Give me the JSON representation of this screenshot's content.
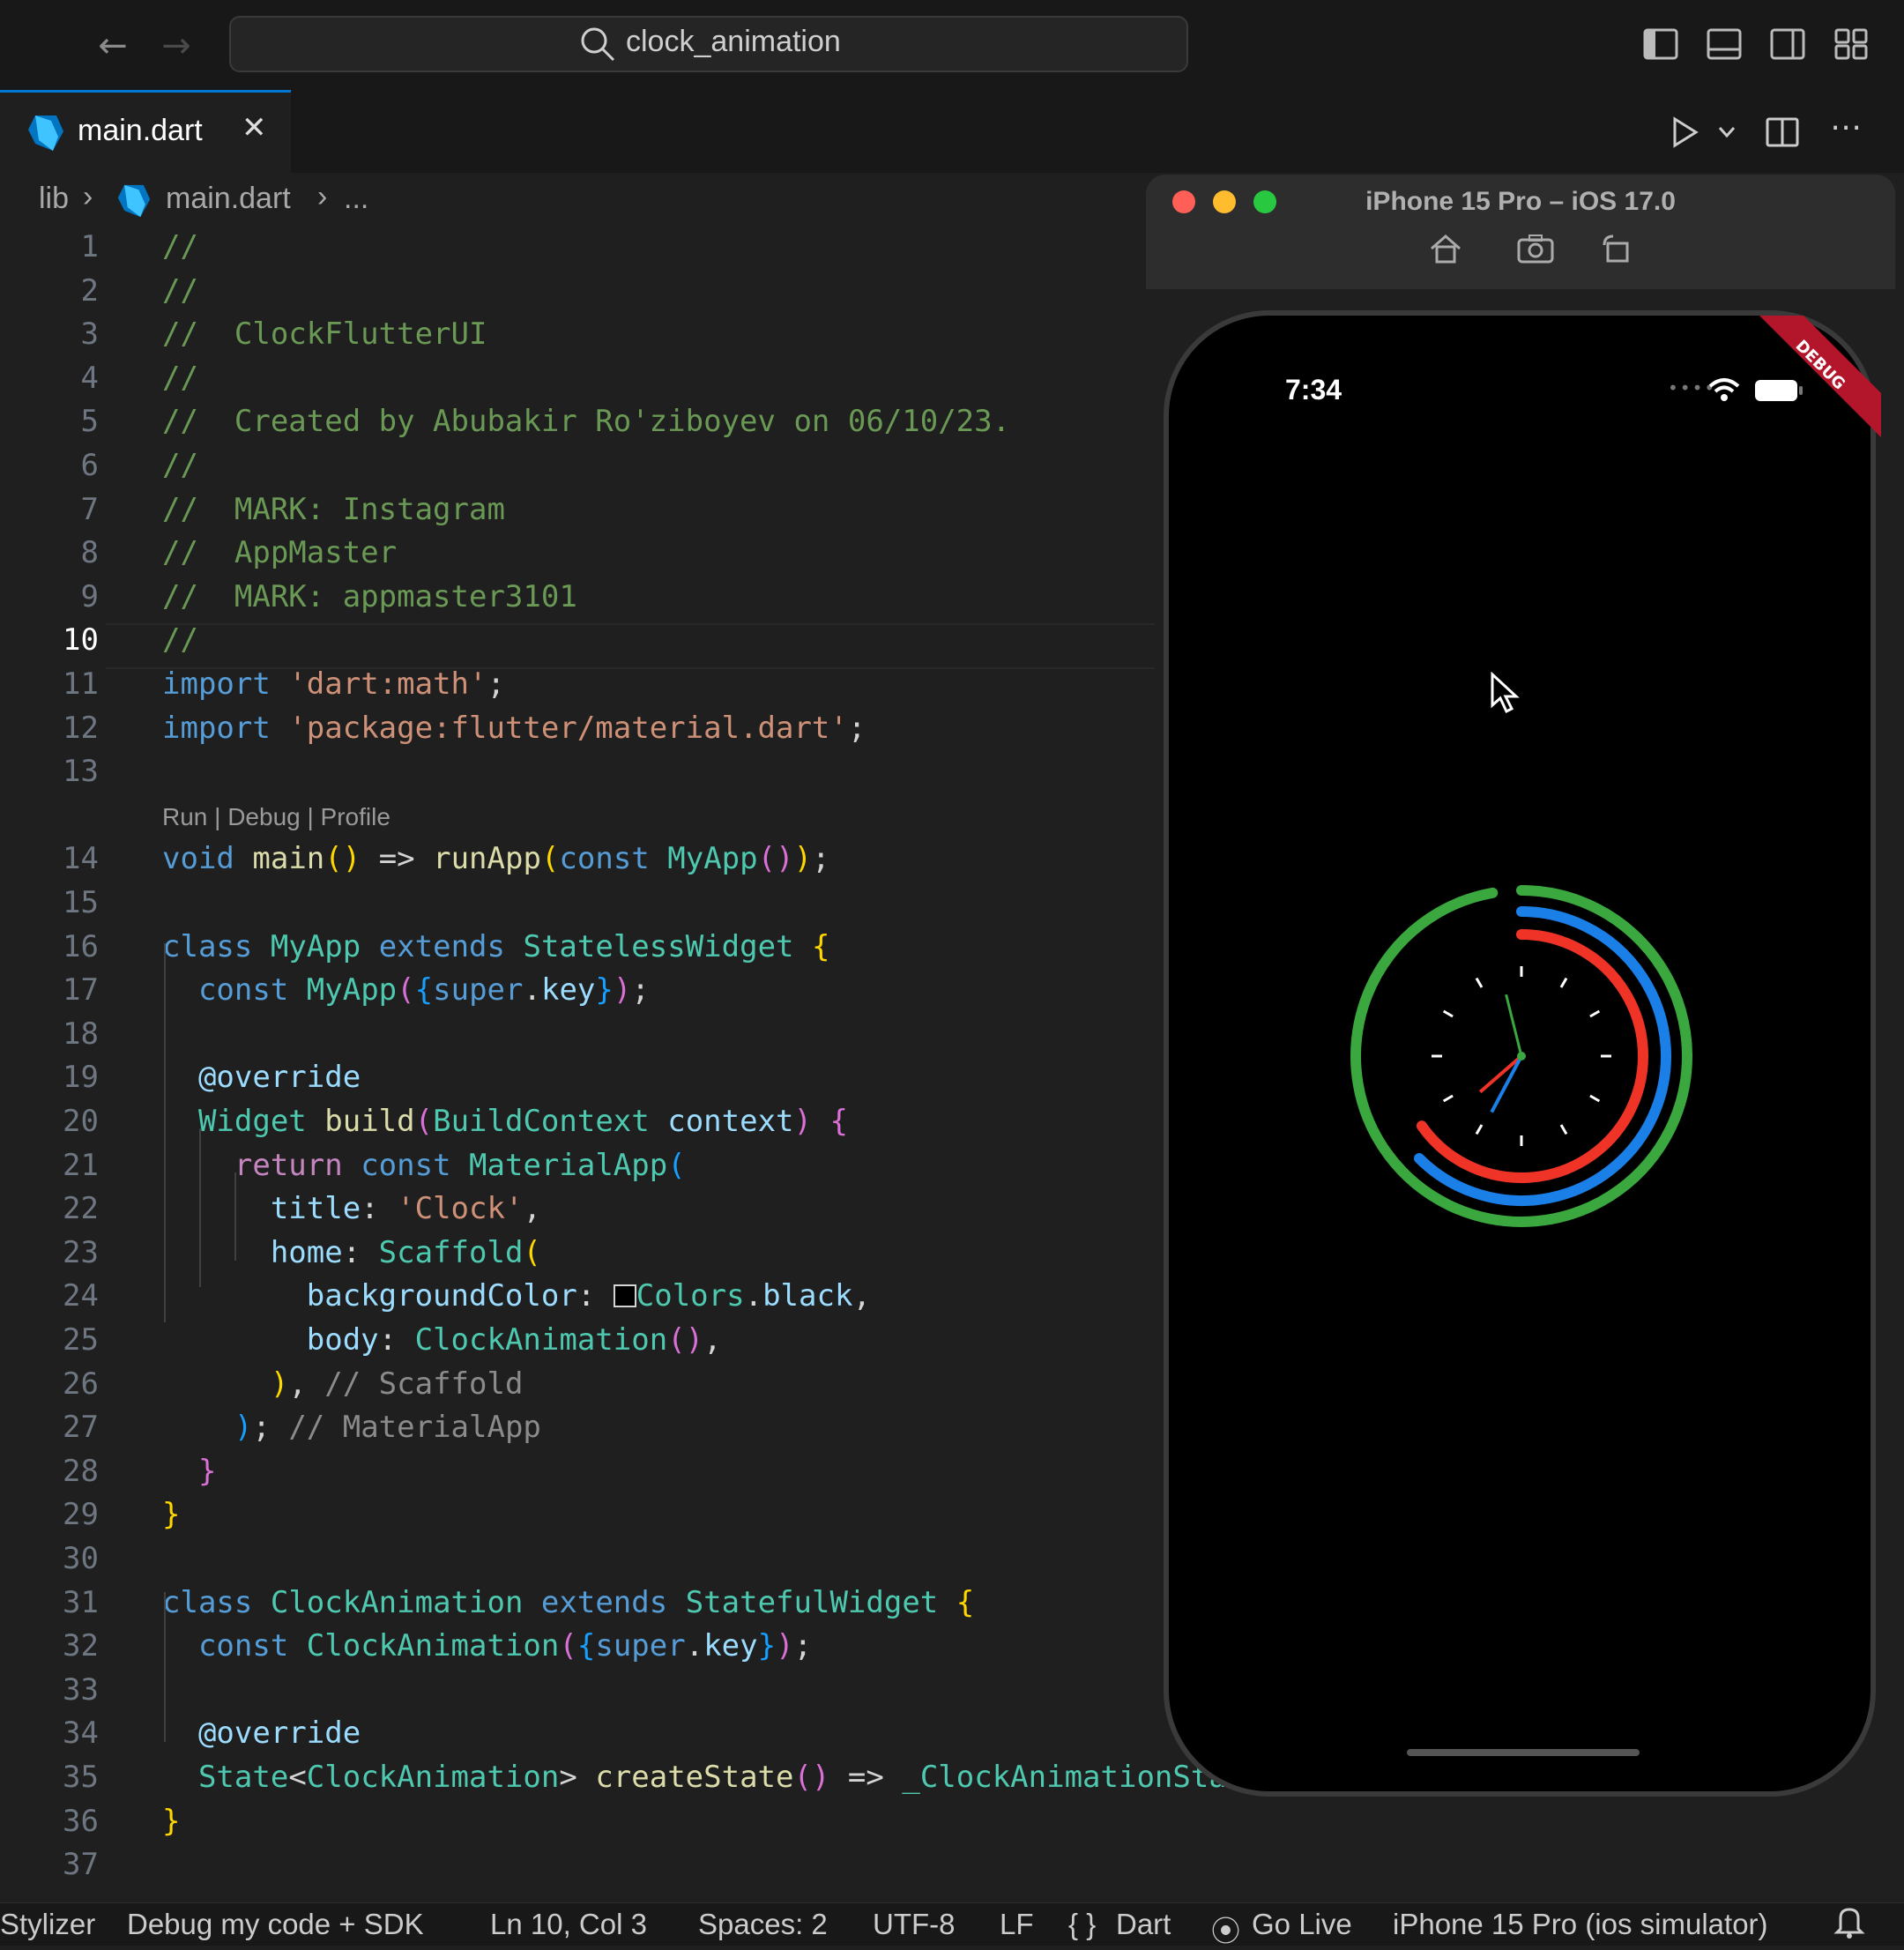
{
  "search": {
    "text": "clock_animation"
  },
  "tab": {
    "label": "main.dart",
    "close": "✕"
  },
  "breadcrumb": {
    "root": "lib",
    "file": "main.dart",
    "more": "..."
  },
  "code_lens": "Run | Debug | Profile",
  "code": [
    {
      "n": "1",
      "html": "<span class='c'>//</span>"
    },
    {
      "n": "2",
      "html": "<span class='c'>//</span>"
    },
    {
      "n": "3",
      "html": "<span class='c'>//  ClockFlutterUI</span>"
    },
    {
      "n": "4",
      "html": "<span class='c'>//</span>"
    },
    {
      "n": "5",
      "html": "<span class='c'>//  Created by Abubakir Ro'ziboyev on 06/10/23.</span>"
    },
    {
      "n": "6",
      "html": "<span class='c'>//</span>"
    },
    {
      "n": "7",
      "html": "<span class='c'>//  MARK: Instagram</span>"
    },
    {
      "n": "8",
      "html": "<span class='c'>//  AppMaster</span>"
    },
    {
      "n": "9",
      "html": "<span class='c'>//  MARK: appmaster3101</span>"
    },
    {
      "n": "10",
      "html": "<span class='c'>//</span>"
    },
    {
      "n": "11",
      "html": "<span class='k'>import</span> <span class='s'>'dart:math'</span>;"
    },
    {
      "n": "12",
      "html": "<span class='k'>import</span> <span class='s'>'package:flutter/material.dart'</span>;"
    },
    {
      "n": "13",
      "html": ""
    },
    {
      "n": "14",
      "html": "<span class='k'>void</span> <span class='f'>main</span><span class='y'>()</span> =&gt; <span class='f'>runApp</span><span class='y'>(</span><span class='k'>const</span> <span class='t'>MyApp</span><span class='p'>()</span><span class='y'>)</span>;"
    },
    {
      "n": "15",
      "html": ""
    },
    {
      "n": "16",
      "html": "<span class='k'>class</span> <span class='t'>MyApp</span> <span class='k'>extends</span> <span class='t'>StatelessWidget</span> <span class='y'>{</span>"
    },
    {
      "n": "17",
      "html": "  <span class='k'>const</span> <span class='t'>MyApp</span><span class='p'>(</span><span class='b'>{</span><span class='k'>super</span>.<span class='v'>key</span><span class='b'>}</span><span class='p'>)</span>;"
    },
    {
      "n": "18",
      "html": ""
    },
    {
      "n": "19",
      "html": "  <span class='v'>@override</span>"
    },
    {
      "n": "20",
      "html": "  <span class='t'>Widget</span> <span class='f'>build</span><span class='p'>(</span><span class='t'>BuildContext</span> <span class='v'>context</span><span class='p'>)</span> <span class='p'>{</span>"
    },
    {
      "n": "21",
      "html": "    <span class='kw'>return</span> <span class='k'>const</span> <span class='t'>MaterialApp</span><span class='b'>(</span>"
    },
    {
      "n": "22",
      "html": "      <span class='v'>title</span>: <span class='s'>'Clock'</span>,"
    },
    {
      "n": "23",
      "html": "      <span class='v'>home</span>: <span class='t'>Scaffold</span><span class='y'>(</span>"
    },
    {
      "n": "24",
      "html": "        <span class='v'>backgroundColor</span>: <span style='display:inline-block;width:22px;height:22px;border:2px solid #d4d4d4;background:#000;vertical-align:-2px;'></span><span class='t'>Colors</span>.<span class='v'>black</span>,"
    },
    {
      "n": "25",
      "html": "        <span class='v'>body</span>: <span class='t'>ClockAnimation</span><span class='p'>()</span>,"
    },
    {
      "n": "26",
      "html": "      <span class='y'>)</span>, <span class='c' style='color:#8b8b8b'>// Scaffold</span>"
    },
    {
      "n": "27",
      "html": "    <span class='b'>)</span>; <span class='c' style='color:#8b8b8b'>// MaterialApp</span>"
    },
    {
      "n": "28",
      "html": "  <span class='p'>}</span>"
    },
    {
      "n": "29",
      "html": "<span class='y'>}</span>"
    },
    {
      "n": "30",
      "html": ""
    },
    {
      "n": "31",
      "html": "<span class='k'>class</span> <span class='t'>ClockAnimation</span> <span class='k'>extends</span> <span class='t'>StatefulWidget</span> <span class='y'>{</span>"
    },
    {
      "n": "32",
      "html": "  <span class='k'>const</span> <span class='t'>ClockAnimation</span><span class='p'>(</span><span class='b'>{</span><span class='k'>super</span>.<span class='v'>key</span><span class='b'>}</span><span class='p'>)</span>;"
    },
    {
      "n": "33",
      "html": ""
    },
    {
      "n": "34",
      "html": "  <span class='v'>@override</span>"
    },
    {
      "n": "35",
      "html": "  <span class='t'>State</span>&lt;<span class='t'>ClockAnimation</span>&gt; <span class='f'>createState</span><span class='p'>()</span> =&gt; <span class='t'>_ClockAnimationStat</span>"
    },
    {
      "n": "36",
      "html": "<span class='y'>}</span>"
    },
    {
      "n": "37",
      "html": ""
    }
  ],
  "simulator": {
    "title": "iPhone 15 Pro – iOS 17.0",
    "time": "7:34",
    "debug_banner": "DEBUG"
  },
  "clock": {
    "ring_colors": {
      "outer": "#3aa83e",
      "middle": "#1a7fe6",
      "inner": "#ef3327"
    },
    "hand_colors": {
      "hour": "#ef3327",
      "minute": "#1a7fe6",
      "second": "#3aa83e"
    },
    "tick_count": 12
  },
  "statusbar": {
    "stylizer": "Stylizer",
    "debug": "Debug my code + SDK",
    "position": "Ln 10, Col 3",
    "spaces": "Spaces: 2",
    "encoding": "UTF-8",
    "eol": "LF",
    "language": "Dart",
    "golive": "Go Live",
    "device": "iPhone 15 Pro (ios simulator)"
  }
}
